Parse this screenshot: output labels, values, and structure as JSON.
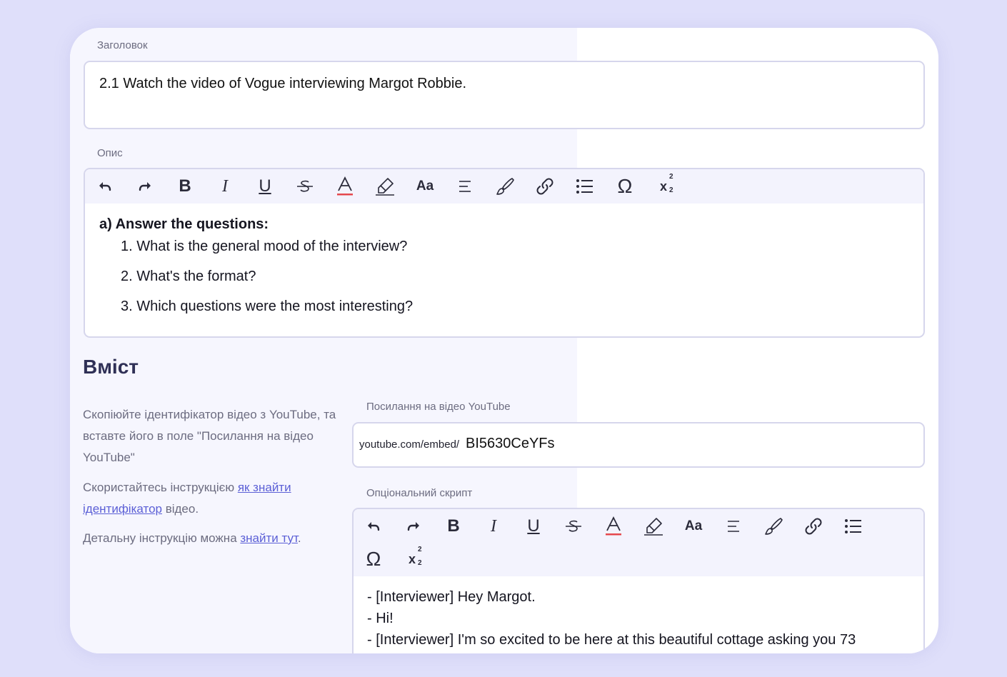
{
  "title_field": {
    "label": "Заголовок",
    "value": "2.1 Watch the video of Vogue interviewing Margot Robbie."
  },
  "description_field": {
    "label": "Опис",
    "heading": "a) Answer the questions:",
    "questions": [
      "1. What is the general mood of the interview?",
      "2. What's the format?",
      "3. Which questions were the most interesting?"
    ]
  },
  "toolbar": {
    "icons": [
      "undo-icon",
      "redo-icon",
      "bold-icon",
      "italic-icon",
      "underline-icon",
      "strikethrough-icon",
      "font-color-icon",
      "highlight-icon",
      "font-size-icon",
      "align-icon",
      "brush-icon",
      "link-icon",
      "list-icon",
      "omega-icon",
      "superscript-subscript-icon"
    ],
    "bold_glyph": "B",
    "italic_glyph": "I",
    "underline_glyph": "U",
    "color_glyph": "A",
    "font_size_glyph": "Aa",
    "omega_glyph": "Ω",
    "supsub_glyph": "x",
    "sup_num": "2",
    "sub_num": "2",
    "accent_red": "#e5484d"
  },
  "content_section": {
    "heading": "Вміст",
    "help_1": "Скопіюйте ідентифікатор відео з YouTube, та вставте його в поле \"Посилання на відео YouTube\"",
    "help_2_prefix": "Скористайтесь інструкцією ",
    "help_2_link": "як знайти ідентифікатор",
    "help_2_suffix": " відео.",
    "help_3_prefix": "Детальну інструкцію можна ",
    "help_3_link": "знайти тут",
    "help_3_suffix": ".",
    "video_label": "Посилання на відео YouTube",
    "video_prefix": "youtube.com/embed/",
    "video_id": "BI5630CeYFs",
    "script_label": "Опціональний скрипт",
    "script_lines": [
      "- [Interviewer] Hey Margot.",
      "- Hi!",
      "- [Interviewer] I'm so excited to be here at this beautiful cottage asking you 73"
    ]
  },
  "colors": {
    "background": "#dfdffa",
    "heading": "#2f3056",
    "link": "#5b5fd6",
    "border": "#d6d6ec"
  }
}
